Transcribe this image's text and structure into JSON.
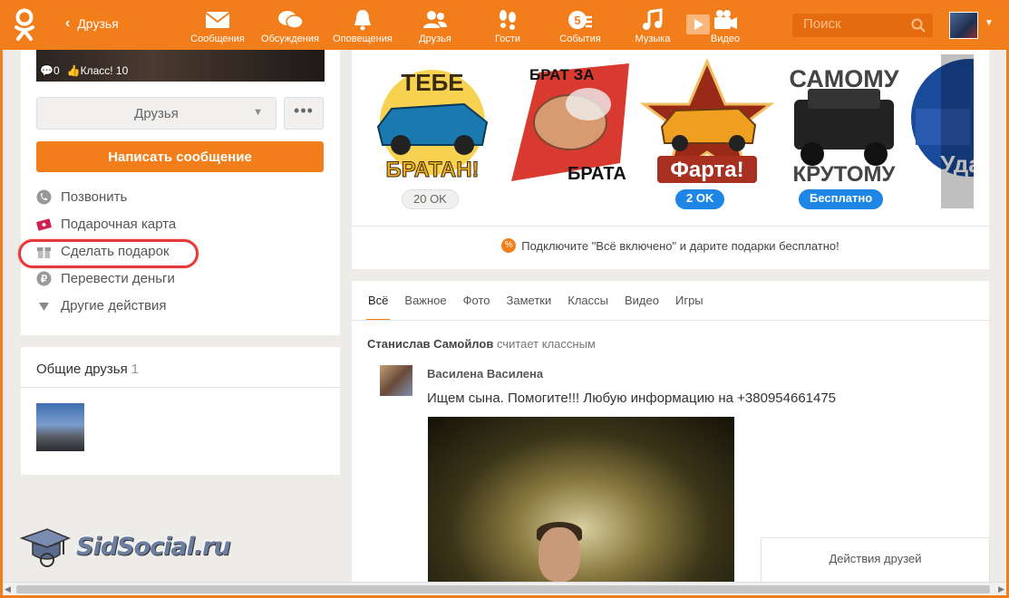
{
  "topbar": {
    "back_label": "Друзья",
    "nav": [
      {
        "label": "Сообщения",
        "icon": "envelope-icon"
      },
      {
        "label": "Обсуждения",
        "icon": "chat-bubbles-icon"
      },
      {
        "label": "Оповещения",
        "icon": "bell-icon"
      },
      {
        "label": "Друзья",
        "icon": "friends-icon"
      },
      {
        "label": "Гости",
        "icon": "footprints-icon"
      },
      {
        "label": "События",
        "icon": "events-icon"
      },
      {
        "label": "Музыка",
        "icon": "music-note-icon"
      },
      {
        "label": "Видео",
        "icon": "video-camera-icon"
      }
    ],
    "search_placeholder": "Поиск",
    "accent": "#f27e1b"
  },
  "profile": {
    "comments_count": "0",
    "likes_label": "Класс! 10",
    "friends_button": "Друзья",
    "more_button": "•••",
    "write_message": "Написать сообщение",
    "actions": [
      {
        "label": "Позвонить",
        "icon": "phone-icon"
      },
      {
        "label": "Подарочная карта",
        "icon": "gift-card-icon"
      },
      {
        "label": "Сделать подарок",
        "icon": "gift-icon"
      },
      {
        "label": "Перевести деньги",
        "icon": "money-icon"
      },
      {
        "label": "Другие действия",
        "icon": "triangle-down-icon"
      }
    ]
  },
  "mutual": {
    "title": "Общие друзья",
    "count": "1"
  },
  "watermark": "SidSocial.ru",
  "gifts": {
    "items": [
      {
        "caption_top": "ТЕБЕ",
        "caption_bottom": "БРАТАН!",
        "price": "20 OK",
        "price_style": "gray"
      },
      {
        "caption_top": "БРАТ ЗА",
        "caption_bottom": "БРАТА",
        "price": "",
        "price_style": "none"
      },
      {
        "caption_top": "",
        "caption_bottom": "Фарта!",
        "price": "2 OK",
        "price_style": "blue"
      },
      {
        "caption_top": "САМОМУ",
        "caption_bottom": "КРУТОМУ",
        "price": "Бесплатно",
        "price_style": "blue"
      },
      {
        "caption_top": "",
        "caption_bottom": "Уда",
        "price": "",
        "price_style": "none"
      }
    ],
    "all_inclusive": "Подключите \"Всё включено\" и дарите подарки бесплатно!"
  },
  "feed": {
    "tabs": [
      "Всё",
      "Важное",
      "Фото",
      "Заметки",
      "Классы",
      "Видео",
      "Игры"
    ],
    "active_tab": "Всё",
    "liker_name": "Станислав Самойлов",
    "liker_action": "считает классным",
    "post_author": "Василена Василена",
    "post_text": "Ищем сына. Помогите!!! Любую информацию на +380954661475"
  },
  "friends_actions": "Действия друзей"
}
